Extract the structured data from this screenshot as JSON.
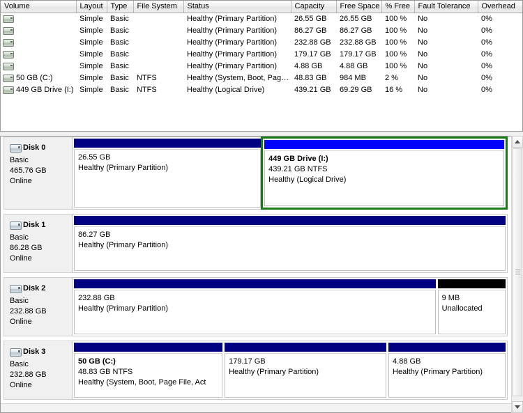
{
  "volume_list": {
    "columns": [
      {
        "key": "volume",
        "label": "Volume",
        "width": 108
      },
      {
        "key": "layout",
        "label": "Layout",
        "width": 44
      },
      {
        "key": "type",
        "label": "Type",
        "width": 38
      },
      {
        "key": "file_system",
        "label": "File System",
        "width": 72
      },
      {
        "key": "status",
        "label": "Status",
        "width": 154
      },
      {
        "key": "capacity",
        "label": "Capacity",
        "width": 65
      },
      {
        "key": "free_space",
        "label": "Free Space",
        "width": 65
      },
      {
        "key": "percent_free",
        "label": "% Free",
        "width": 47
      },
      {
        "key": "fault_tolerance",
        "label": "Fault Tolerance",
        "width": 91
      },
      {
        "key": "overhead",
        "label": "Overhead",
        "width": 64
      }
    ],
    "rows": [
      {
        "icon": "drive-icon",
        "volume": "",
        "layout": "Simple",
        "type": "Basic",
        "file_system": "",
        "status": "Healthy (Primary Partition)",
        "capacity": "26.55 GB",
        "free_space": "26.55 GB",
        "percent_free": "100 %",
        "fault_tolerance": "No",
        "overhead": "0%"
      },
      {
        "icon": "drive-icon",
        "volume": "",
        "layout": "Simple",
        "type": "Basic",
        "file_system": "",
        "status": "Healthy (Primary Partition)",
        "capacity": "86.27 GB",
        "free_space": "86.27 GB",
        "percent_free": "100 %",
        "fault_tolerance": "No",
        "overhead": "0%"
      },
      {
        "icon": "drive-icon",
        "volume": "",
        "layout": "Simple",
        "type": "Basic",
        "file_system": "",
        "status": "Healthy (Primary Partition)",
        "capacity": "232.88 GB",
        "free_space": "232.88 GB",
        "percent_free": "100 %",
        "fault_tolerance": "No",
        "overhead": "0%"
      },
      {
        "icon": "drive-icon",
        "volume": "",
        "layout": "Simple",
        "type": "Basic",
        "file_system": "",
        "status": "Healthy (Primary Partition)",
        "capacity": "179.17 GB",
        "free_space": "179.17 GB",
        "percent_free": "100 %",
        "fault_tolerance": "No",
        "overhead": "0%"
      },
      {
        "icon": "drive-icon",
        "volume": "",
        "layout": "Simple",
        "type": "Basic",
        "file_system": "",
        "status": "Healthy (Primary Partition)",
        "capacity": "4.88 GB",
        "free_space": "4.88 GB",
        "percent_free": "100 %",
        "fault_tolerance": "No",
        "overhead": "0%"
      },
      {
        "icon": "drive-icon",
        "volume": "50 GB (C:)",
        "layout": "Simple",
        "type": "Basic",
        "file_system": "NTFS",
        "status": "Healthy (System, Boot, Pag…",
        "capacity": "48.83 GB",
        "free_space": "984 MB",
        "percent_free": "2 %",
        "fault_tolerance": "No",
        "overhead": "0%"
      },
      {
        "icon": "drive-icon",
        "volume": "449 GB Drive (I:)",
        "layout": "Simple",
        "type": "Basic",
        "file_system": "NTFS",
        "status": "Healthy (Logical Drive)",
        "capacity": "439.21 GB",
        "free_space": "69.29 GB",
        "percent_free": "16 %",
        "fault_tolerance": "No",
        "overhead": "0%"
      }
    ]
  },
  "colors": {
    "primary_partition_bar": "#000080",
    "logical_drive_bar": "#0000ff",
    "unallocated_bar": "#000000",
    "selection_border": "#1a7a1a",
    "disk_info_background": "#f0f0f0"
  },
  "graphical_view": {
    "disks": [
      {
        "name": "Disk 0",
        "type": "Basic",
        "size": "465.76 GB",
        "state": "Online",
        "icon": "disk-icon",
        "height": 105,
        "partitions": [
          {
            "title": "",
            "size": "26.55 GB",
            "fs": "",
            "status": "Healthy (Primary Partition)",
            "bar_color": "#000080",
            "flex": 269,
            "selected": false
          },
          {
            "title": "449 GB Drive  (I:)",
            "size": "439.21 GB NTFS",
            "fs": "",
            "status": "Healthy (Logical Drive)",
            "bar_color": "#0000ff",
            "flex": 345,
            "selected": true
          }
        ]
      },
      {
        "name": "Disk 1",
        "type": "Basic",
        "size": "86.28 GB",
        "state": "Online",
        "icon": "disk-icon",
        "height": 85,
        "partitions": [
          {
            "title": "",
            "size": "86.27 GB",
            "fs": "",
            "status": "Healthy (Primary Partition)",
            "bar_color": "#000080",
            "flex": 545,
            "selected": false
          }
        ]
      },
      {
        "name": "Disk 2",
        "type": "Basic",
        "size": "232.88 GB",
        "state": "Online",
        "icon": "disk-icon",
        "height": 85,
        "partitions": [
          {
            "title": "",
            "size": "232.88 GB",
            "fs": "",
            "status": "Healthy (Primary Partition)",
            "bar_color": "#000080",
            "flex": 495,
            "selected": false
          },
          {
            "title": "",
            "size": "9 MB",
            "fs": "",
            "status": "Unallocated",
            "bar_color": "#000000",
            "flex": 93,
            "selected": false
          }
        ]
      },
      {
        "name": "Disk 3",
        "type": "Basic",
        "size": "232.88 GB",
        "state": "Online",
        "icon": "disk-icon",
        "height": 85,
        "partitions": [
          {
            "title": "50 GB  (C:)",
            "size": "48.83 GB NTFS",
            "fs": "",
            "status": "Healthy (System, Boot, Page File, Act",
            "bar_color": "#000080",
            "flex": 203,
            "selected": false
          },
          {
            "title": "",
            "size": "179.17 GB",
            "fs": "",
            "status": "Healthy (Primary Partition)",
            "bar_color": "#000080",
            "flex": 221,
            "selected": false
          },
          {
            "title": "",
            "size": "4.88 GB",
            "fs": "",
            "status": "Healthy (Primary Partition)",
            "bar_color": "#000080",
            "flex": 160,
            "selected": false
          }
        ]
      }
    ]
  },
  "scrollbar": {
    "up_arrow": "scroll-up-arrow",
    "down_arrow": "scroll-down-arrow",
    "thumb": "scroll-thumb"
  }
}
